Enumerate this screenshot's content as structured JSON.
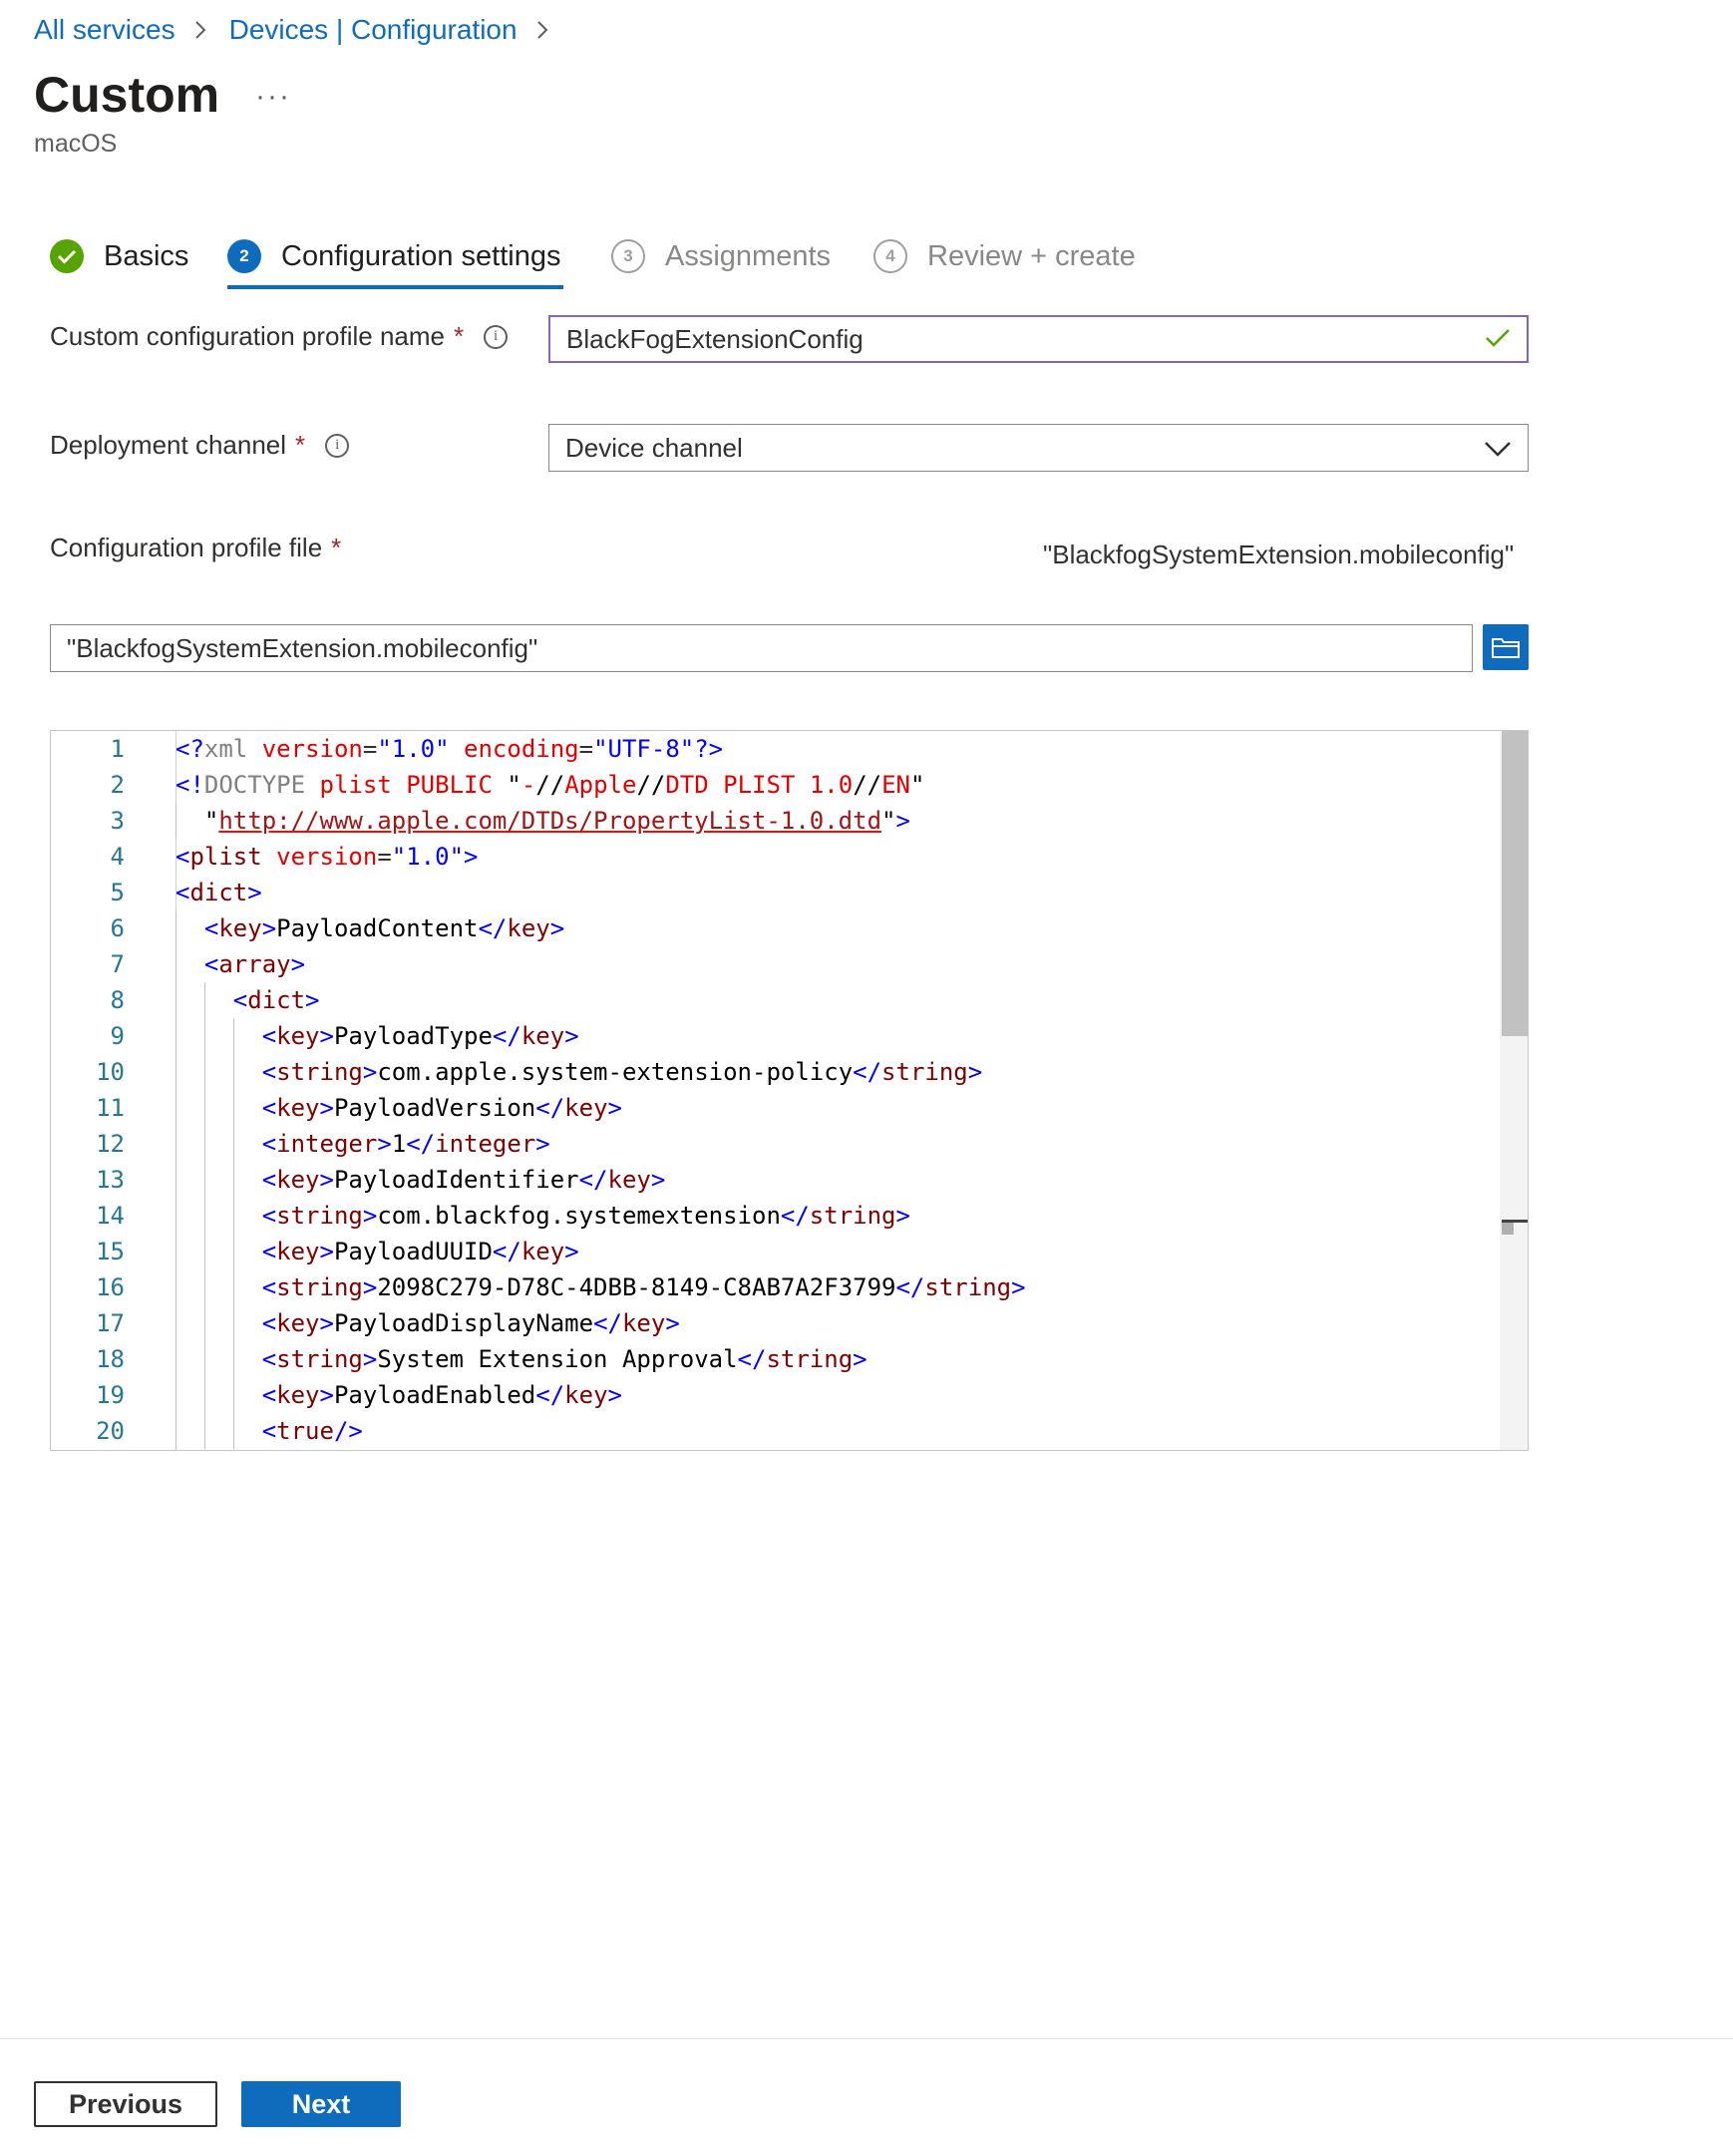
{
  "breadcrumb": {
    "items": [
      "All services",
      "Devices | Configuration"
    ]
  },
  "page": {
    "title": "Custom",
    "more_label": "···",
    "subtitle": "macOS"
  },
  "wizard": {
    "steps": [
      {
        "number": "1",
        "label": "Basics",
        "status": "completed"
      },
      {
        "number": "2",
        "label": "Configuration settings",
        "status": "active"
      },
      {
        "number": "3",
        "label": "Assignments",
        "status": "pending"
      },
      {
        "number": "4",
        "label": "Review + create",
        "status": "pending"
      }
    ]
  },
  "form": {
    "required_marker": "*",
    "info_glyph": "i",
    "profile_name": {
      "label": "Custom configuration profile name",
      "value": "BlackFogExtensionConfig",
      "valid": true
    },
    "deployment_channel": {
      "label": "Deployment channel",
      "selected": "Device channel"
    },
    "profile_file": {
      "label": "Configuration profile file",
      "selected_file": "\"BlackfogSystemExtension.mobileconfig\"",
      "input_value": "\"BlackfogSystemExtension.mobileconfig\""
    }
  },
  "editor": {
    "line_numbers": [
      "1",
      "2",
      "3",
      "4",
      "5",
      "6",
      "7",
      "8",
      "9",
      "10",
      "11",
      "12",
      "13",
      "14",
      "15",
      "16",
      "17",
      "18",
      "19",
      "20"
    ]
  },
  "footer": {
    "previous_label": "Previous",
    "next_label": "Next"
  },
  "colors": {
    "accent": "#0f6cbd",
    "success": "#57a300",
    "required": "#a4262c",
    "valid_border": "#8764b8"
  }
}
